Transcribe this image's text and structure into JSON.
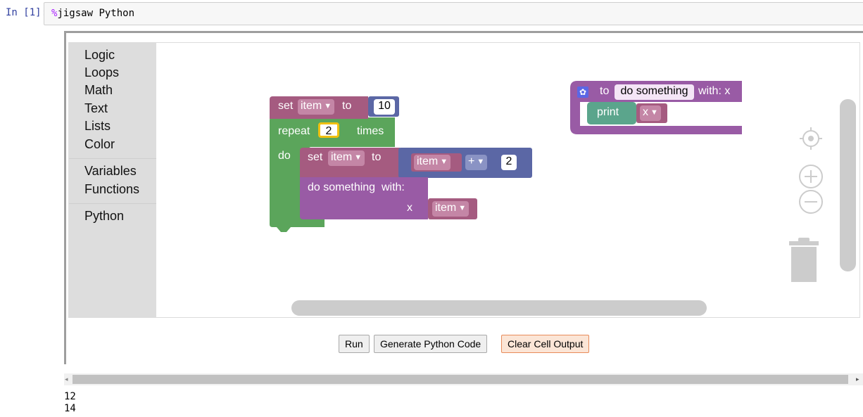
{
  "notebook": {
    "prompt": "In [1]:",
    "cell_magic": "%",
    "cell_code": "jigsaw Python"
  },
  "toolbox": {
    "categories": [
      "Logic",
      "Loops",
      "Math",
      "Text",
      "Lists",
      "Color",
      "Variables",
      "Functions",
      "Python"
    ]
  },
  "blocks": {
    "set1": {
      "keyword": "set",
      "var": "item",
      "to": "to",
      "value": "10"
    },
    "repeat": {
      "keyword": "repeat",
      "count": "2",
      "times": "times",
      "do": "do"
    },
    "set2": {
      "keyword": "set",
      "var": "item",
      "to": "to",
      "left": "item",
      "op": "+",
      "right": "2"
    },
    "call": {
      "label": "do something",
      "with": "with:",
      "param": "x",
      "arg": "item"
    },
    "def": {
      "to": "to",
      "name": "do something",
      "with": "with: x"
    },
    "print": {
      "keyword": "print",
      "arg": "x"
    }
  },
  "buttons": {
    "run": "Run",
    "generate": "Generate Python Code",
    "clear": "Clear Cell Output"
  },
  "output": {
    "lines": "12\n14"
  },
  "colors": {
    "variable": "#a55b80",
    "loop": "#5ba55b",
    "math": "#5b67a5",
    "procedure": "#995ba5",
    "print": "#5ba58c"
  }
}
